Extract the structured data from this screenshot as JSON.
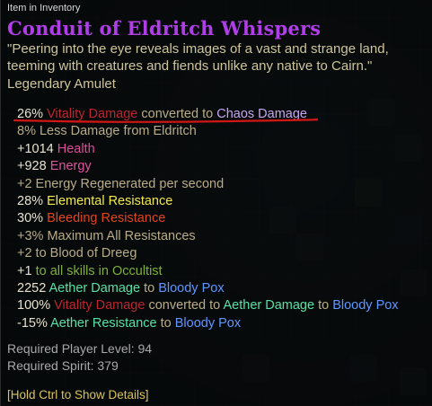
{
  "header": {
    "label": "Item in Inventory"
  },
  "item": {
    "name": "Conduit of Eldritch Whispers",
    "flavor_line_1": "\"Peering into the eye reveals images of a vast and strange land,",
    "flavor_line_2": "teeming with creatures and fiends unlike any native to Cairn.\"",
    "type": "Legendary Amulet"
  },
  "mods": {
    "m1_value": "26%",
    "m1_source": "Vitality Damage",
    "m1_mid": "converted to",
    "m1_target": "Chaos Damage",
    "m2": "8% Less Damage from Eldritch",
    "m3_value": "+1014",
    "m3_stat": "Health",
    "m4_value": "+928",
    "m4_stat": "Energy",
    "m5": "+2 Energy Regenerated per second",
    "m6_value": "28%",
    "m6_stat": "Elemental Resistance",
    "m7_value": "30%",
    "m7_stat": "Bleeding Resistance",
    "m8": "+3% Maximum All Resistances",
    "m9": "+2 to Blood of Dreeg",
    "m10_value": "+1",
    "m10_rest": "to all skills in Occultist",
    "m11_value": "2252",
    "m11_type": "Aether Damage",
    "m11_to": "to",
    "m11_skill": "Bloody Pox",
    "m12_value": "100%",
    "m12_source": "Vitality Damage",
    "m12_mid": "converted to",
    "m12_target": "Aether Damage",
    "m12_to": "to",
    "m12_skill": "Bloody Pox",
    "m13_value": "-15%",
    "m13_stat": "Aether Resistance",
    "m13_to": "to",
    "m13_skill": "Bloody Pox"
  },
  "requirements": {
    "level": "Required Player Level: 94",
    "spirit": "Required Spirit: 379"
  },
  "hint": "[Hold Ctrl to Show Details]",
  "colors": {
    "title": "#b03ee8",
    "vitality": "#c0232b",
    "chaos": "#c7a6f0",
    "aether": "#54e3a8",
    "skill": "#5f96ff",
    "elemental": "#f2e94a",
    "annotation_underline": "#d11616"
  }
}
